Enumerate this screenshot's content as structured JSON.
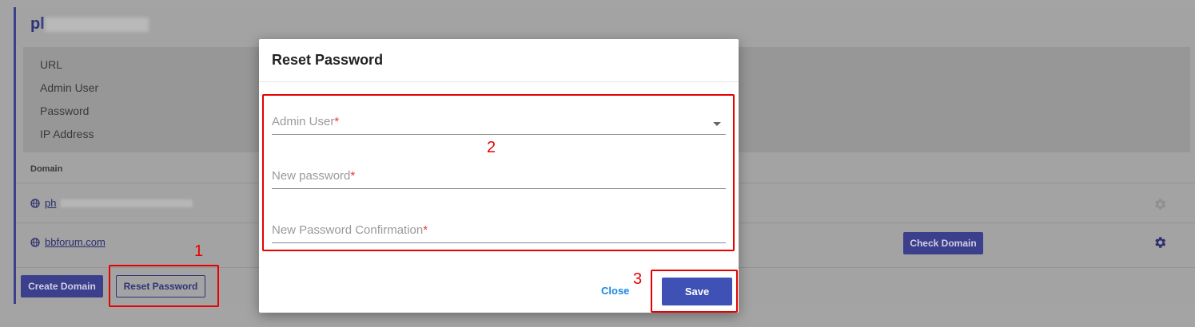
{
  "background": {
    "title_prefix": "pl",
    "info_labels": [
      "URL",
      "Admin User",
      "Password",
      "IP Address"
    ],
    "domain_header": "Domain",
    "domains": [
      {
        "name": "ph"
      },
      {
        "name": "bbforum.com"
      }
    ],
    "check_domain_label": "Check Domain",
    "create_domain_label": "Create Domain",
    "reset_password_label": "Reset Password"
  },
  "modal": {
    "title": "Reset Password",
    "fields": [
      {
        "label": "Admin User",
        "required_mark": "*"
      },
      {
        "label": "New password",
        "required_mark": "*"
      },
      {
        "label": "New Password Confirmation",
        "required_mark": "*"
      }
    ],
    "close_label": "Close",
    "save_label": "Save"
  },
  "annotations": [
    "1",
    "2",
    "3"
  ],
  "colors": {
    "primary": "#3f51b5",
    "annotation": "#e60000",
    "link": "#1e88e5"
  }
}
